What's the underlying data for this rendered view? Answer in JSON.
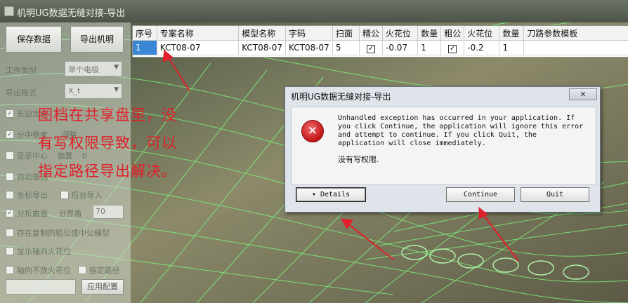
{
  "window": {
    "title": "机明UG数据无缝对接-导出"
  },
  "left_panel": {
    "save_button": "保存数据",
    "export_button": "导出机明",
    "workpiece_type_label": "工件类型",
    "workpiece_type_value": "单个电极",
    "export_format_label": "导出格式",
    "export_format_value": "X_t",
    "row_long_edge": "长边定向",
    "row_split": "分中参考",
    "row_split_value": "调整",
    "row_show_center": "显示中心",
    "row_offset_label": "偏置",
    "row_offset_value": "0",
    "row_auto_select": "自动框选",
    "row_coord_export": "坐标导出",
    "row_background_import": "后台导入",
    "row_analyze_surface": "分析曲面",
    "row_split_angle_label": "分界角",
    "row_split_angle_value": "70",
    "row_existing": "存在复制的粗公或中公模型",
    "row_show_axial": "显示轴向火花位",
    "row_no_axial": "轴向不放火花位",
    "row_specify_path": "指定路径",
    "apply_button": "应用配置"
  },
  "grid": {
    "headers": [
      "序号",
      "专案名称",
      "模型名称",
      "字码",
      "扫面",
      "精公",
      "火花位",
      "数量",
      "粗公",
      "火花位",
      "数量",
      "刀路参数模板"
    ],
    "row": {
      "index": "1",
      "project": "KCT08-07",
      "model": "KCT08-07",
      "code": "KCT08-07",
      "scan": "5",
      "fine_checked": true,
      "fine_spark": "-0.07",
      "fine_qty": "1",
      "rough_checked": true,
      "rough_spark": "-0.2",
      "rough_qty": "1",
      "template": ""
    }
  },
  "annotation": {
    "line1": "图档在共享盘里，没",
    "line2": "有写权限导致，可以",
    "line3": "指定路径导出解决。"
  },
  "dialog": {
    "title": "机明UG数据无缝对接-导出",
    "close_label": "✕",
    "message": "Unhandled exception has occurred in your application. If you click Continue, the application will ignore this error and attempt to continue. If you click Quit, the application will close immediately.",
    "detail_message": "没有写权限.",
    "details_button": "Details",
    "continue_button": "Continue",
    "quit_button": "Quit"
  },
  "colors": {
    "annotation": "#e0202a",
    "selection": "#3a87d6",
    "error_icon": "#c11414"
  }
}
